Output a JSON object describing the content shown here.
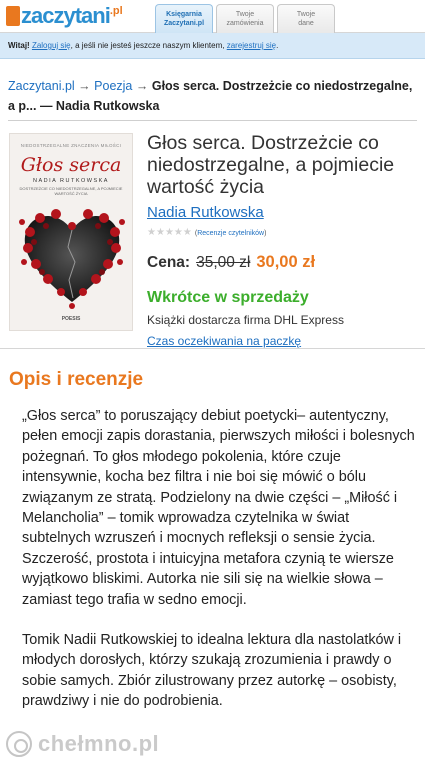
{
  "header": {
    "logo_text": "zaczytani",
    "logo_suffix": ".pl",
    "tabs": [
      {
        "line1": "Księgarnia",
        "line2": "Zaczytani.pl"
      },
      {
        "line1": "Twoje",
        "line2": "zamówienia"
      },
      {
        "line1": "Twoje",
        "line2": "dane"
      }
    ]
  },
  "login": {
    "greeting": "Witaj!",
    "login_link": "Zaloguj się",
    "middle": ", a jeśli nie jesteś jeszcze naszym klientem,",
    "register_link": "zarejestruj się",
    "end": "."
  },
  "breadcrumb": {
    "home": "Zaczytani.pl",
    "sep1": " → ",
    "category": "Poezja",
    "sep2": " → ",
    "current": "Głos serca. Dostrzeżcie co niedostrzegalne, a p... — Nadia Rutkowska"
  },
  "cover": {
    "top": "NIEDOSTRZEGALNE ZNACZENIA MIŁOŚCI",
    "title": "Głos serca",
    "author": "NADIA RUTKOWSKA",
    "subtitle": "DOSTRZEŻCIE CO NIEDOSTRZEGALNE, A POJMIECIE WARTOŚĆ ŻYCIA",
    "publisher": "POESIS"
  },
  "product": {
    "title": "Głos serca. Dostrzeżcie co niedostrzegalne, a pojmiecie wartość życia",
    "author": "Nadia Rutkowska",
    "rating_stars": 5,
    "reviews_open": "(",
    "reviews_link": "Recenzje czytelników",
    "reviews_close": ")",
    "price_label": "Cena:",
    "old_price": "35,00 zł",
    "new_price": "30,00 zł",
    "availability": "Wkrótce w sprzedaży",
    "shipping": "Książki dostarcza firma DHL Express",
    "wait_link": "Czas oczekiwania na paczkę"
  },
  "description": {
    "heading": "Opis i recenzje",
    "p1": "„Głos serca” to poruszający debiut poetycki– autentyczny, pełen emocji zapis dorastania, pierwszych miłości i bolesnych pożegnań. To głos młodego pokolenia, które czuje intensywnie, kocha bez filtra i nie boi się mówić o bólu związanym ze stratą. Podzielony na dwie części – „Miłość i Melancholia” – tomik wprowadza czytelnika w świat subtelnych wzruszeń i mocnych refleksji o sensie życia. Szczerość, prostota i intuicyjna metafora czynią te wiersze wyjątkowo bliskimi. Autorka nie sili się na wielkie słowa – zamiast tego trafia w sedno emocji.",
    "p2": "Tomik Nadii Rutkowskiej to idealna lektura dla nastolatków i młodych dorosłych, którzy szukają zrozumienia i prawdy o sobie samych. Zbiór zilustrowany przez autorkę – osobisty, prawdziwy i nie do podrobienia."
  },
  "watermark": "chełmno.pl",
  "colors": {
    "accent": "#e9781f",
    "link": "#1e6fc0",
    "available": "#3cae2c"
  }
}
